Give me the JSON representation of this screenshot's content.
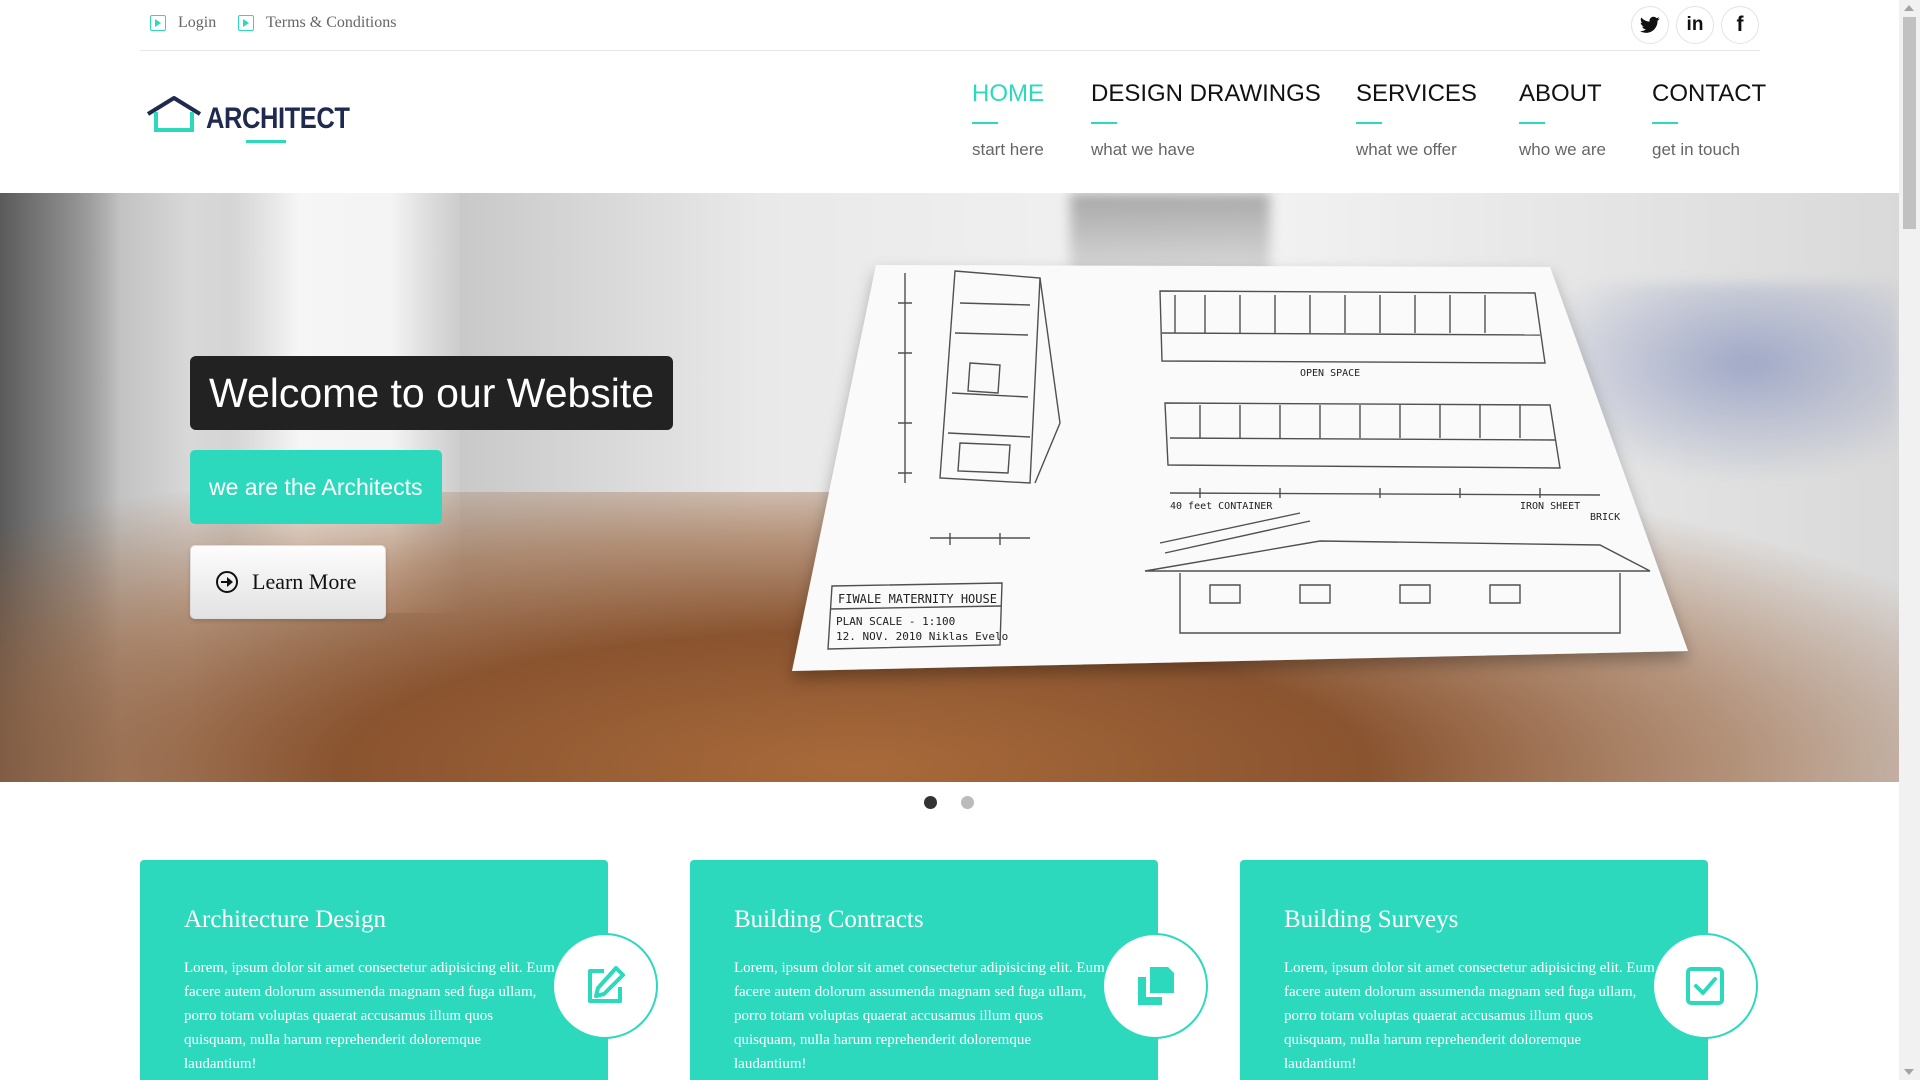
{
  "topbar": {
    "login_label": "Login",
    "terms_label": "Terms & Conditions",
    "social": [
      {
        "icon": "twitter-icon",
        "glyph": "𝕏"
      },
      {
        "icon": "linkedin-icon",
        "glyph": "in"
      },
      {
        "icon": "facebook-icon",
        "glyph": "f"
      }
    ]
  },
  "logo": {
    "text": "ARCHITECT"
  },
  "nav": [
    {
      "label": "HOME",
      "sub": "start here",
      "active": true
    },
    {
      "label": "DESIGN DRAWINGS",
      "sub": "what we have"
    },
    {
      "label": "SERVICES",
      "sub": "what we offer"
    },
    {
      "label": "ABOUT",
      "sub": "who we are"
    },
    {
      "label": "CONTACT",
      "sub": "get in touch"
    }
  ],
  "hero": {
    "title": "Welcome to our Website",
    "tagline": "we are the Architects",
    "button_label": "Learn More",
    "slides": 2,
    "active_slide": 1,
    "drawing": {
      "title_block": "FIWALE MATERNITY HOUSE",
      "scale_line": "PLAN  SCALE - 1:100",
      "date_line": "12. NOV. 2010   Niklas Evelo",
      "open_space": "OPEN SPACE",
      "container": "40 feet CONTAINER",
      "iron_sheet": "IRON SHEET",
      "brick": "BRICK"
    }
  },
  "services": [
    {
      "title": "Architecture Design",
      "text": "Lorem, ipsum dolor sit amet consectetur adipisicing elit. Eum facere autem dolorum assumenda magnam sed fuga ullam, porro totam voluptas quaerat accusamus illum quos quisquam, nulla harum reprehenderit doloremque laudantium!",
      "icon": "edit-icon"
    },
    {
      "title": "Building Contracts",
      "text": "Lorem, ipsum dolor sit amet consectetur adipisicing elit. Eum facere autem dolorum assumenda magnam sed fuga ullam, porro totam voluptas quaerat accusamus illum quos quisquam, nulla harum reprehenderit doloremque laudantium!",
      "icon": "copy-icon"
    },
    {
      "title": "Building Surveys",
      "text": "Lorem, ipsum dolor sit amet consectetur adipisicing elit. Eum facere autem dolorum assumenda magnam sed fuga ullam, porro totam voluptas quaerat accusamus illum quos quisquam, nulla harum reprehenderit doloremque laudantium!",
      "icon": "check-square-icon"
    }
  ],
  "colors": {
    "accent": "#2dd9bd",
    "dark": "#222222",
    "navy": "#1f2a4e"
  }
}
